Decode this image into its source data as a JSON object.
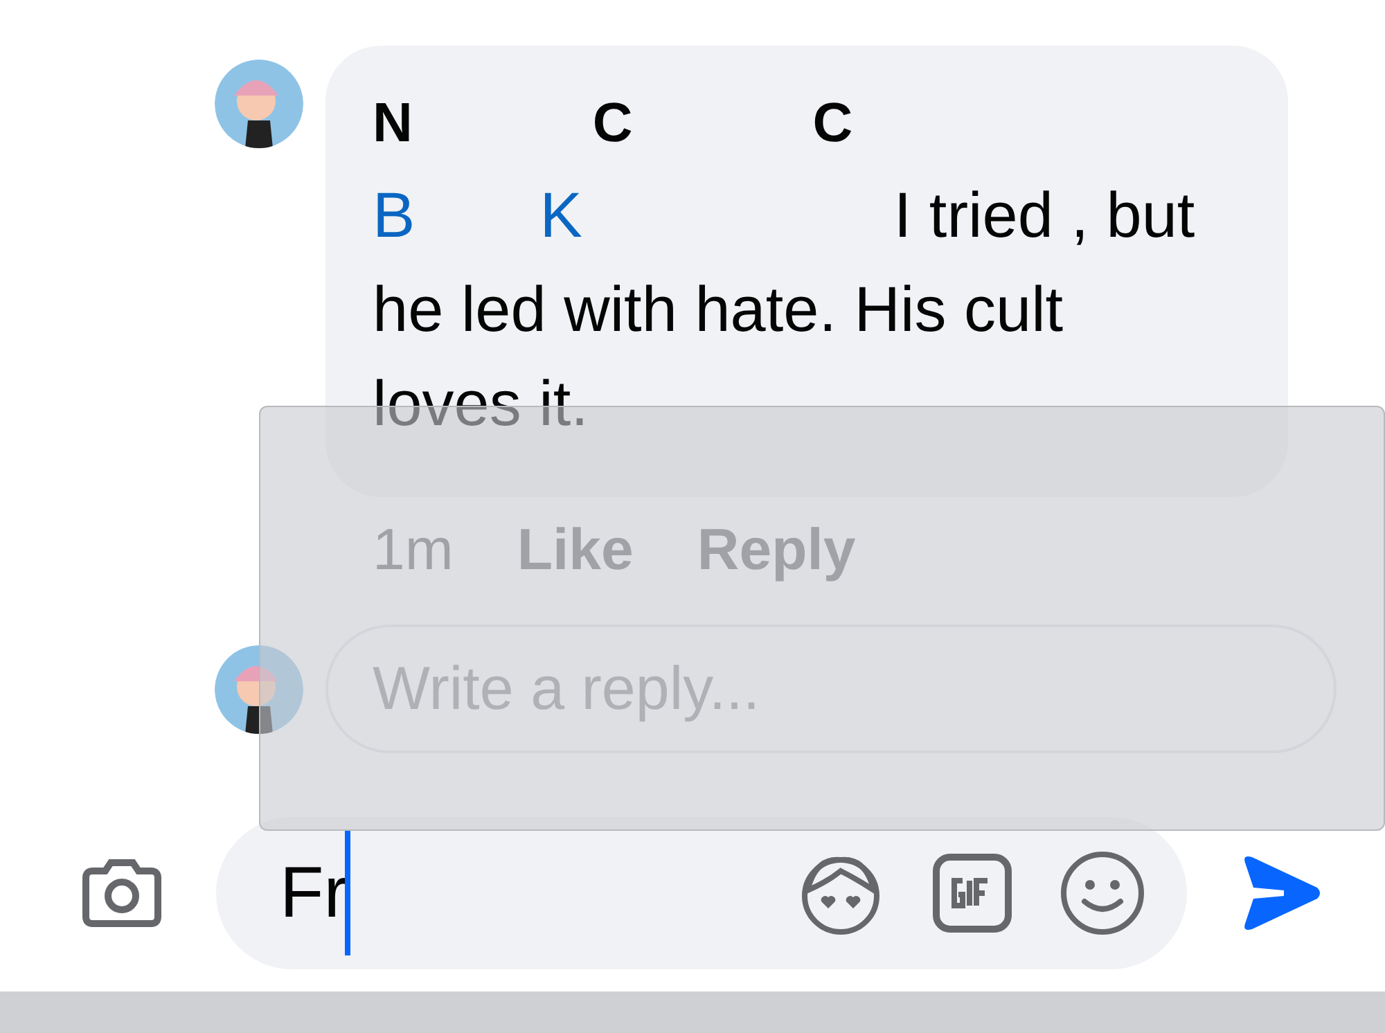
{
  "comment": {
    "author_parts": [
      "N",
      "C",
      "C"
    ],
    "mentions": [
      "B",
      "K"
    ],
    "text": "I tried , but he led with hate. His cult loves it.",
    "time": "1m",
    "actions": [
      "Like",
      "Reply"
    ]
  },
  "reply_field": {
    "placeholder": "Write a reply..."
  },
  "composer": {
    "value": "Fr"
  }
}
